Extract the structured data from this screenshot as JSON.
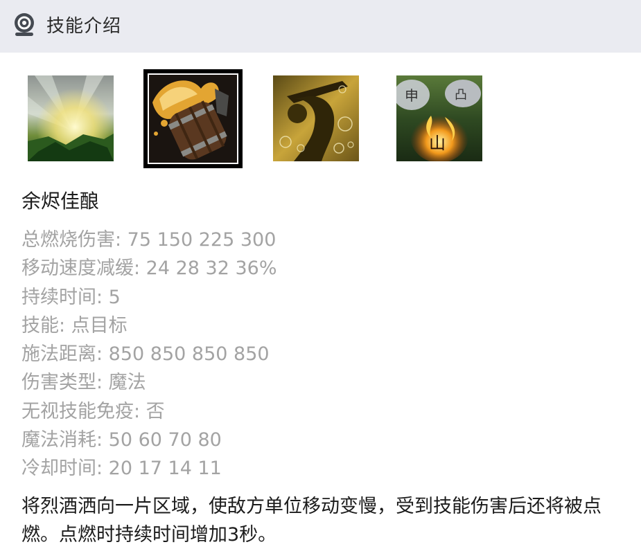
{
  "header": {
    "title": "技能介绍",
    "icon": "target-badge-icon"
  },
  "skills": [
    {
      "icon": "nature-burst-icon",
      "selected": false
    },
    {
      "icon": "ale-barrel-icon",
      "selected": true
    },
    {
      "icon": "drunken-brawler-icon",
      "selected": false
    },
    {
      "icon": "elemental-rune-icon",
      "selected": false
    }
  ],
  "ability": {
    "name": "余烬佳酿",
    "stats": [
      "总燃烧伤害: 75 150 225 300",
      "移动速度减缓: 24 28 32 36%",
      "持续时间: 5",
      "技能: 点目标",
      "施法距离: 850 850 850 850",
      "伤害类型: 魔法",
      "无视技能免疫: 否",
      "魔法消耗: 50 60 70 80",
      "冷却时间: 20 17 14 11"
    ],
    "description": "将烈酒洒向一片区域，使敌方单位移动变慢，受到技能伤害后还将被点燃。点燃时持续时间增加3秒。"
  },
  "colors": {
    "header_bg": "#eaebf1",
    "stat_text": "#a3a3a3",
    "primary_text": "#1b1b1b"
  }
}
